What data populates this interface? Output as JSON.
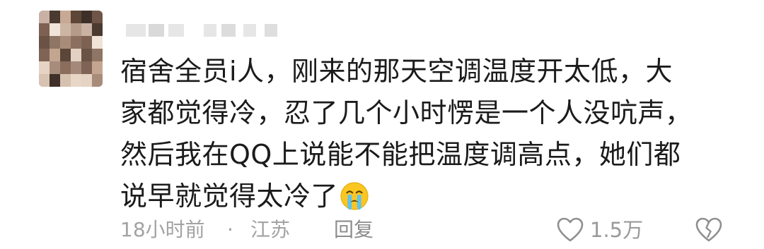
{
  "comment": {
    "lines": [
      "宿舍全员i人，刚来的那天空调温度开太低，大",
      "家都觉得冷，忍了几个小时愣是一个人没吭声，",
      "然后我在QQ上说能不能把温度调高点，她们都",
      "说早就觉得太冷了"
    ],
    "emoji": "crying-face-emoji"
  },
  "meta": {
    "time": "18小时前",
    "separator": "·",
    "location": "江苏",
    "reply_label": "回复",
    "like_count": "1.5万"
  },
  "icons": {
    "like": "heart-outline-icon",
    "dislike": "broken-heart-outline-icon"
  },
  "colors": {
    "text": "#1b1b1b",
    "meta_text": "#a3a3a3",
    "icon_stroke": "#8f8f8f",
    "emoji_face": "#f9c623"
  }
}
